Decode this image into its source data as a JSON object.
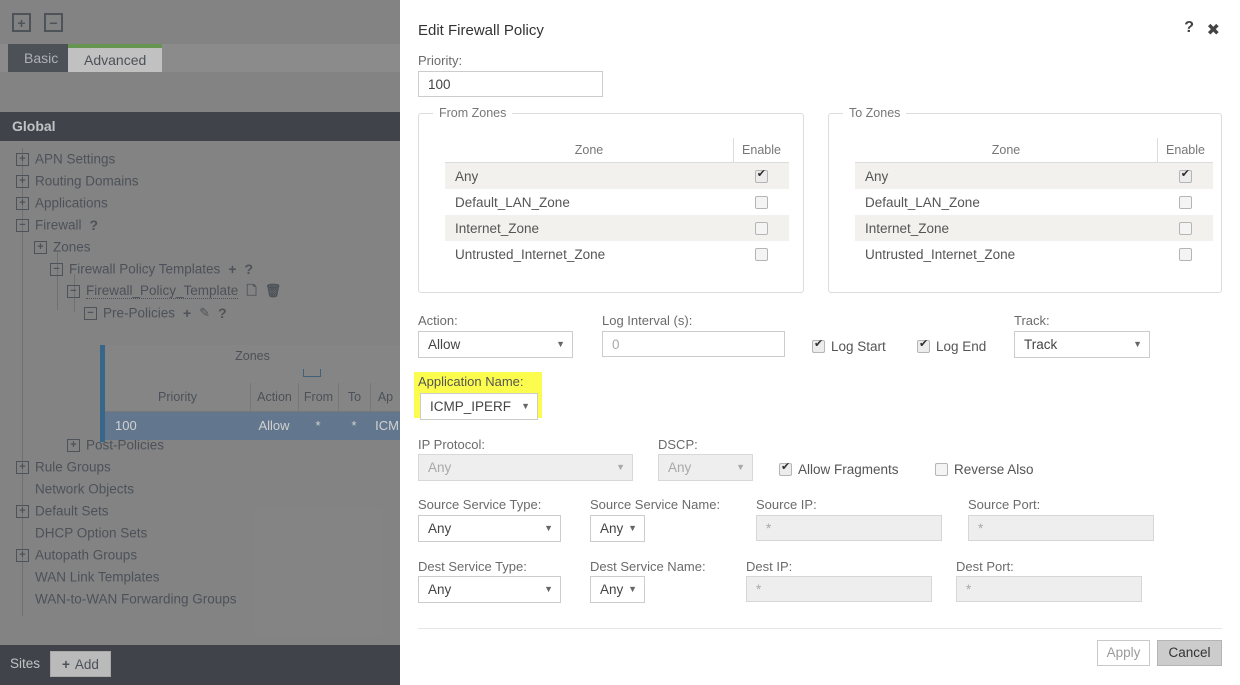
{
  "background": {
    "toolbar": {
      "expand_all": "+",
      "collapse_all": "−"
    },
    "tabs": [
      {
        "label": "Basic",
        "active": true
      },
      {
        "label": "Advanced",
        "active": false
      }
    ],
    "section_header": "Global",
    "tree": [
      {
        "label": "APN Settings",
        "node": "+",
        "depth": 0
      },
      {
        "label": "Routing Domains",
        "node": "+",
        "depth": 0
      },
      {
        "label": "Applications",
        "node": "+",
        "depth": 0
      },
      {
        "label": "Firewall",
        "node": "−",
        "depth": 0,
        "icons": [
          "?"
        ]
      },
      {
        "label": "Zones",
        "node": "+",
        "depth": 1
      },
      {
        "label": "Firewall Policy Templates",
        "node": "−",
        "depth": 2,
        "icons": [
          "+",
          "?"
        ]
      },
      {
        "label": "Firewall_Policy_Template",
        "node": "−",
        "depth": 3,
        "icons": [
          "copy-icon",
          "trash-icon"
        ]
      },
      {
        "label": "Pre-Policies",
        "node": "−",
        "depth": 4,
        "icons": [
          "+",
          "pencil-icon",
          "?"
        ]
      },
      {
        "label": "Post-Policies",
        "node": "+",
        "depth": 4
      },
      {
        "label": "Rule Groups",
        "node": "+",
        "depth": 0
      },
      {
        "label": "Network Objects",
        "node": "",
        "depth": 0
      },
      {
        "label": "Default Sets",
        "node": "+",
        "depth": 0
      },
      {
        "label": "DHCP Option Sets",
        "node": "",
        "depth": 0
      },
      {
        "label": "Autopath Groups",
        "node": "+",
        "depth": 0
      },
      {
        "label": "WAN Link Templates",
        "node": "",
        "depth": 0
      },
      {
        "label": "WAN-to-WAN Forwarding Groups",
        "node": "",
        "depth": 0
      }
    ],
    "grid": {
      "group_header": "Zones",
      "columns": [
        "Priority",
        "Action",
        "From",
        "To",
        "Ap"
      ],
      "rows": [
        {
          "priority": "100",
          "action": "Allow",
          "from": "*",
          "to": "*",
          "app": "ICM"
        }
      ]
    },
    "footer": {
      "label": "Sites",
      "add_plus": "+",
      "add_label": "Add"
    }
  },
  "dialog": {
    "title": "Edit Firewall Policy",
    "help_icon": "?",
    "close_icon": "✖",
    "priority": {
      "label": "Priority:",
      "value": "100"
    },
    "from_zones": {
      "legend": "From Zones",
      "col_zone": "Zone",
      "col_enable": "Enable",
      "rows": [
        {
          "zone": "Any",
          "enabled": true
        },
        {
          "zone": "Default_LAN_Zone",
          "enabled": false
        },
        {
          "zone": "Internet_Zone",
          "enabled": false
        },
        {
          "zone": "Untrusted_Internet_Zone",
          "enabled": false
        }
      ]
    },
    "to_zones": {
      "legend": "To Zones",
      "col_zone": "Zone",
      "col_enable": "Enable",
      "rows": [
        {
          "zone": "Any",
          "enabled": true
        },
        {
          "zone": "Default_LAN_Zone",
          "enabled": false
        },
        {
          "zone": "Internet_Zone",
          "enabled": false
        },
        {
          "zone": "Untrusted_Internet_Zone",
          "enabled": false
        }
      ]
    },
    "action": {
      "label": "Action:",
      "value": "Allow"
    },
    "log_interval": {
      "label": "Log Interval (s):",
      "value": "",
      "placeholder": "0"
    },
    "log_start": {
      "label": "Log Start",
      "checked": true
    },
    "log_end": {
      "label": "Log End",
      "checked": true
    },
    "track": {
      "label": "Track:",
      "value": "Track"
    },
    "application_name": {
      "label": "Application Name:",
      "value": "ICMP_IPERF",
      "highlight_color": "#fcfc4f",
      "highlighted": true
    },
    "ip_protocol": {
      "label": "IP Protocol:",
      "value": "Any",
      "disabled": true
    },
    "dscp": {
      "label": "DSCP:",
      "value": "Any",
      "disabled": true
    },
    "allow_fragments": {
      "label": "Allow Fragments",
      "checked": true
    },
    "reverse_also": {
      "label": "Reverse Also",
      "checked": false
    },
    "source_service_type": {
      "label": "Source Service Type:",
      "value": "Any"
    },
    "source_service_name": {
      "label": "Source Service Name:",
      "value": "Any"
    },
    "source_ip": {
      "label": "Source IP:",
      "value": "",
      "placeholder": "*",
      "disabled": true
    },
    "source_port": {
      "label": "Source Port:",
      "value": "",
      "placeholder": "*",
      "disabled": true
    },
    "dest_service_type": {
      "label": "Dest Service Type:",
      "value": "Any"
    },
    "dest_service_name": {
      "label": "Dest Service Name:",
      "value": "Any"
    },
    "dest_ip": {
      "label": "Dest IP:",
      "value": "",
      "placeholder": "*",
      "disabled": true
    },
    "dest_port": {
      "label": "Dest Port:",
      "value": "",
      "placeholder": "*",
      "disabled": true
    },
    "apply_button": {
      "label": "Apply",
      "disabled": true
    },
    "cancel_button": {
      "label": "Cancel",
      "disabled": false
    }
  }
}
